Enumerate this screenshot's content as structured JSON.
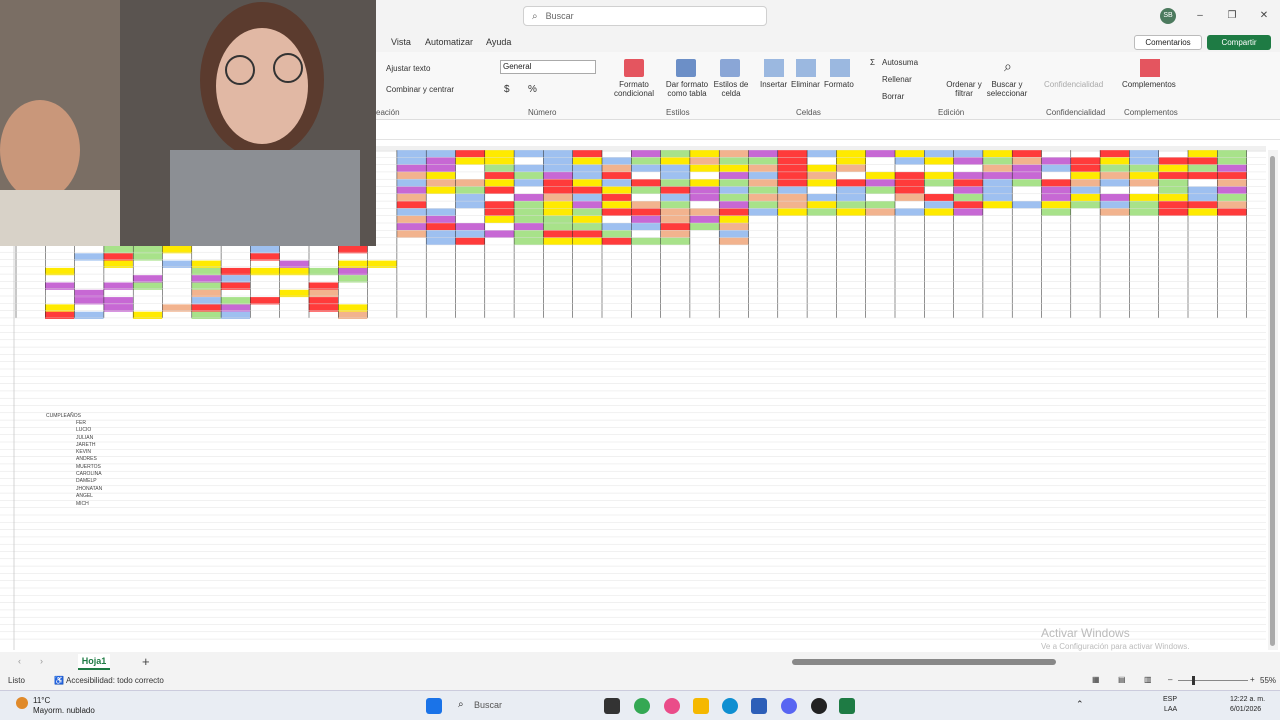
{
  "titlebar": {
    "search_placeholder": "Buscar",
    "user_initials": "SB"
  },
  "menu": {
    "tabs": [
      "Vista",
      "Automatizar",
      "Ayuda"
    ],
    "comments_label": "Comentarios",
    "share_label": "Compartir"
  },
  "ribbon": {
    "wrap_text": "Ajustar texto",
    "merge_center": "Combinar y centrar",
    "alignment_group_partial": "eación",
    "number_format_value": "General",
    "number_group": "Número",
    "conditional_format": "Formato condicional",
    "format_as_table": "Dar formato como tabla",
    "cell_styles": "Estilos de celda",
    "styles_group": "Estilos",
    "insert": "Insertar",
    "delete": "Eliminar",
    "format": "Formato",
    "cells_group": "Celdas",
    "autosum": "Autosuma",
    "fill": "Rellenar",
    "clear": "Borrar",
    "sort_filter": "Ordenar y filtrar",
    "find_select": "Buscar y seleccionar",
    "editing_group": "Edición",
    "confidentiality": "Confidencialidad",
    "confidentiality_group": "Confidencialidad",
    "addins": "Complementos",
    "addins_group": "Complementos"
  },
  "sheet": {
    "tab_name": "Hoja1",
    "notes": [
      "CUMPLEAÑOS",
      "FER",
      "LUCIO",
      "JULIAN",
      "JARETH",
      "KEVIN",
      "ANDRES",
      "MUERTOS",
      "CAROLINA",
      "DAMELP",
      "JHONATAN",
      "ANGEL",
      "MICH"
    ]
  },
  "status": {
    "ready": "Listo",
    "accessibility": "Accesibilidad: todo correcto",
    "zoom": "55%"
  },
  "watermark": {
    "title": "Activar Windows",
    "subtitle": "Ve a Configuración para activar Windows."
  },
  "taskbar": {
    "weather_temp": "11°C",
    "weather_desc": "Mayorm. nublado",
    "search": "Buscar",
    "lang1": "ESP",
    "lang2": "LAA",
    "time": "12:22 a. m.",
    "date": "6/01/2026"
  }
}
